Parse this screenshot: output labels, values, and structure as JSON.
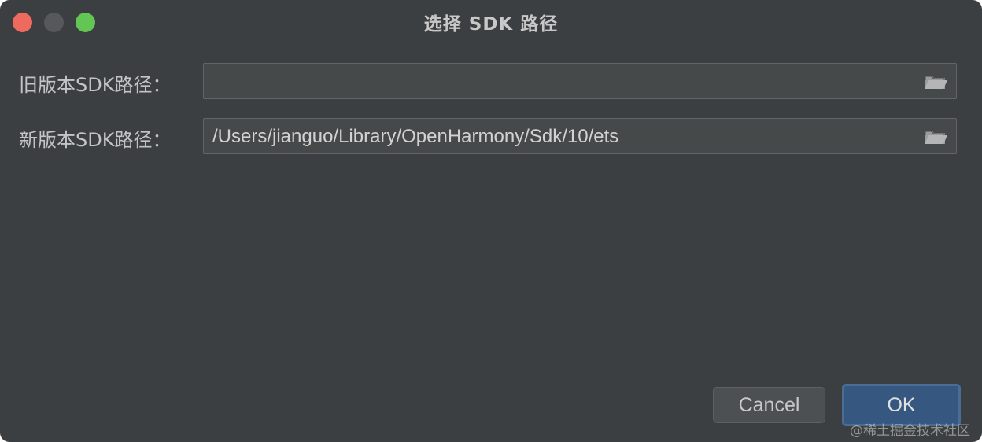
{
  "window": {
    "title": "选择 SDK 路径"
  },
  "form": {
    "old_sdk": {
      "label": "旧版本SDK路径：",
      "value": "",
      "browse_icon": "folder-open-icon"
    },
    "new_sdk": {
      "label": "新版本SDK路径：",
      "value": "/Users/jianguo/Library/OpenHarmony/Sdk/10/ets",
      "browse_icon": "folder-open-icon"
    }
  },
  "buttons": {
    "cancel_label": "Cancel",
    "ok_label": "OK"
  },
  "watermark": "@稀土掘金技术社区",
  "colors": {
    "background": "#3c3f41",
    "field_background": "#45494a",
    "ok_accent": "#365880",
    "close": "#ee6a5f",
    "minimize": "#56585a",
    "maximize": "#62c554"
  }
}
